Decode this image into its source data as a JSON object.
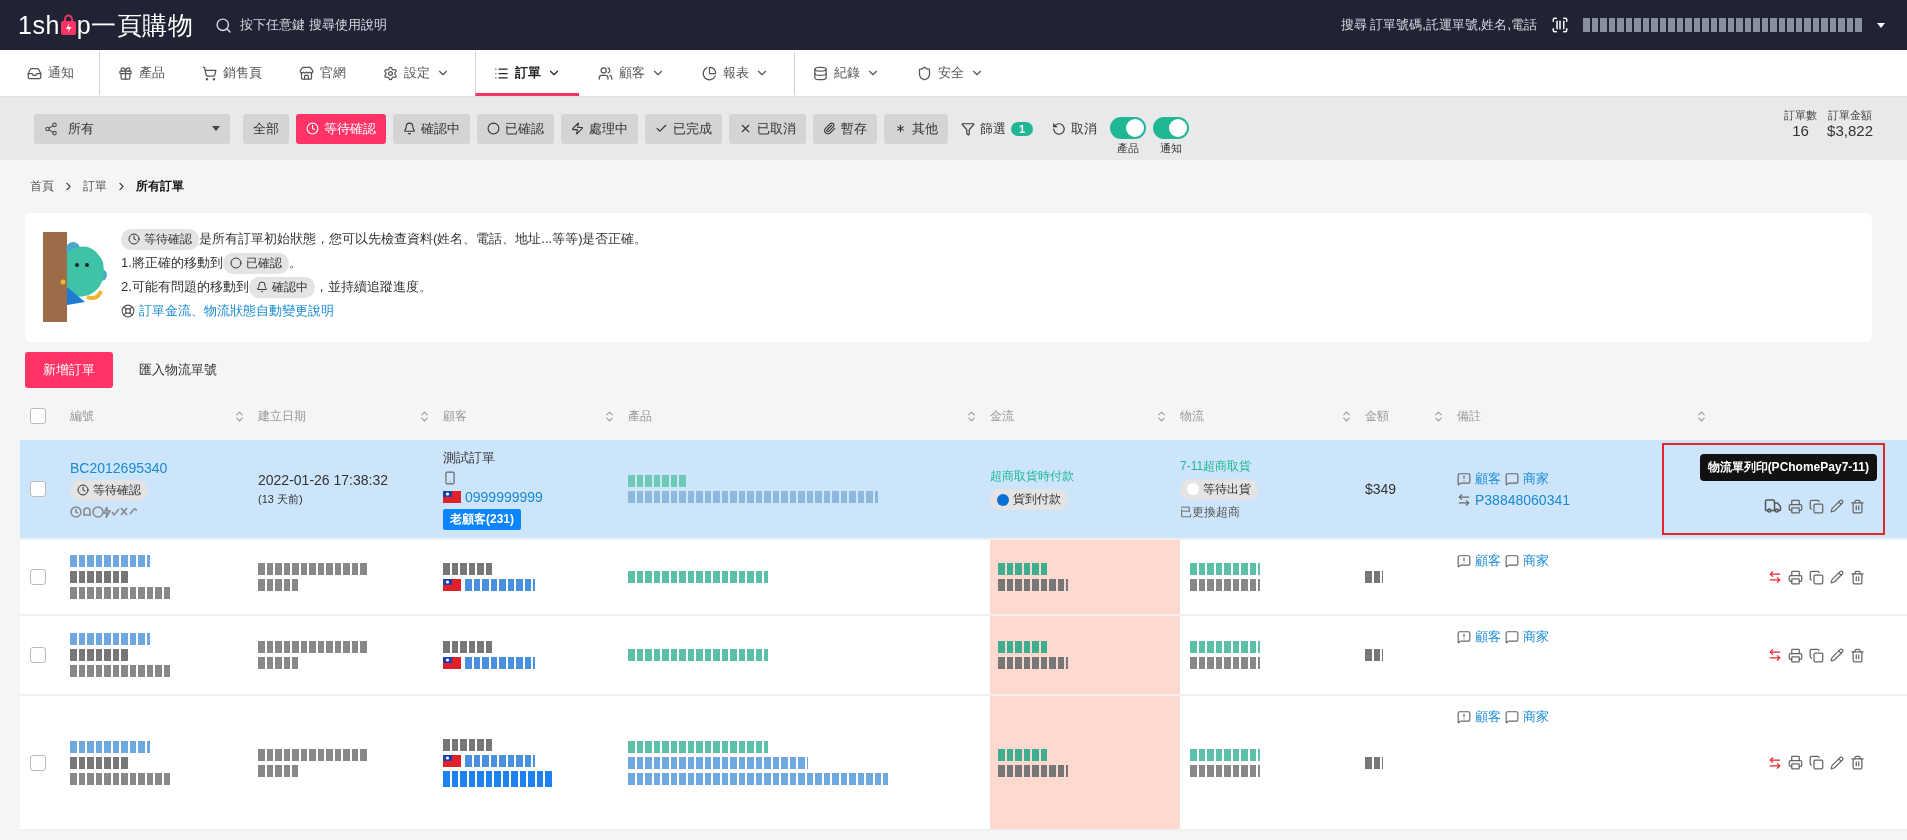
{
  "topbar": {
    "logo_start": "1sh",
    "logo_end": "p",
    "logo_brand": "一頁購物",
    "help_hint": "按下任意鍵 搜尋使用說明",
    "order_search": "搜尋 訂單號碼,託運單號,姓名,電話"
  },
  "nav": [
    {
      "label": "通知",
      "dropdown": false,
      "selected": false,
      "divider_before": false
    },
    {
      "label": "產品",
      "dropdown": false,
      "selected": false,
      "divider_before": true
    },
    {
      "label": "銷售頁",
      "dropdown": false,
      "selected": false,
      "divider_before": false
    },
    {
      "label": "官網",
      "dropdown": false,
      "selected": false,
      "divider_before": false
    },
    {
      "label": "設定",
      "dropdown": true,
      "selected": false,
      "divider_before": false
    },
    {
      "label": "訂單",
      "dropdown": true,
      "selected": true,
      "divider_before": true
    },
    {
      "label": "顧客",
      "dropdown": true,
      "selected": false,
      "divider_before": false
    },
    {
      "label": "報表",
      "dropdown": true,
      "selected": false,
      "divider_before": false
    },
    {
      "label": "紀錄",
      "dropdown": true,
      "selected": false,
      "divider_before": true
    },
    {
      "label": "安全",
      "dropdown": true,
      "selected": false,
      "divider_before": false
    }
  ],
  "filter": {
    "select": "所有",
    "statuses": [
      {
        "label": "全部",
        "selected": false
      },
      {
        "label": "等待確認",
        "selected": true
      },
      {
        "label": "確認中",
        "selected": false
      },
      {
        "label": "已確認",
        "selected": false
      },
      {
        "label": "處理中",
        "selected": false
      },
      {
        "label": "已完成",
        "selected": false
      },
      {
        "label": "已取消",
        "selected": false
      },
      {
        "label": "暫存",
        "selected": false
      },
      {
        "label": "其他",
        "selected": false
      }
    ],
    "filter_label": "篩選",
    "filter_count": "1",
    "cancel": "取消",
    "toggles": [
      {
        "label": "產品",
        "on": true
      },
      {
        "label": "通知",
        "on": true
      }
    ],
    "stats": [
      {
        "label": "訂單數",
        "value": "16"
      },
      {
        "label": "訂單金額",
        "value": "$3,822"
      }
    ]
  },
  "breadcrumb": [
    "首頁",
    "訂單",
    "所有訂單"
  ],
  "notice": {
    "badge": "等待確認",
    "intro": "是所有訂單初始狀態，您可以先檢查資料(姓名、電話、地址...等等)是否正確。",
    "steps": [
      {
        "before": "1.將正確的移動到",
        "badge": "已確認",
        "after": "。"
      },
      {
        "before": "2.可能有問題的移動到",
        "badge": "確認中",
        "after": "，並持續追蹤進度。"
      }
    ],
    "link": "訂單金流、物流狀態自動變更說明"
  },
  "actions": {
    "primary": "新增訂單",
    "secondary": "匯入物流單號"
  },
  "table": {
    "header_checked": false,
    "columns": [
      "編號",
      "建立日期",
      "顧客",
      "產品",
      "金流",
      "物流",
      "金額",
      "備註"
    ],
    "rows": [
      {
        "kind": "detail",
        "selected": true,
        "checked": false,
        "order_no": "BC2012695340",
        "status": "等待確認",
        "date": "2022-01-26 17:38:32",
        "ago": "(13 天前)",
        "customer": "測試訂單",
        "phone": "0999999999",
        "tag": "老顧客(231)",
        "payment_type": "超商取貨時付款",
        "payment_status": {
          "label": "貨到付款",
          "color": "#0a6fd6"
        },
        "shipping_type": "7-11超商取貨",
        "shipping_status": {
          "label": "等待出貨",
          "color": "#ffffff"
        },
        "shipping_note": "已更換超商",
        "amount": "$349",
        "note_customer": "顧客",
        "note_merchant": "商家",
        "tracking": "P38848060341",
        "tooltip": "物流單列印(PChomePay7-11)",
        "outlined": true
      },
      {
        "kind": "redacted",
        "selected": false,
        "checked": false,
        "flagged": true,
        "note_customer": "顧客",
        "note_merchant": "商家"
      },
      {
        "kind": "redacted",
        "selected": false,
        "checked": false,
        "flagged": true,
        "note_customer": "顧客",
        "note_merchant": "商家"
      },
      {
        "kind": "redacted",
        "selected": false,
        "checked": false,
        "flagged": true,
        "note_customer": "顧客",
        "note_merchant": "商家"
      }
    ]
  }
}
